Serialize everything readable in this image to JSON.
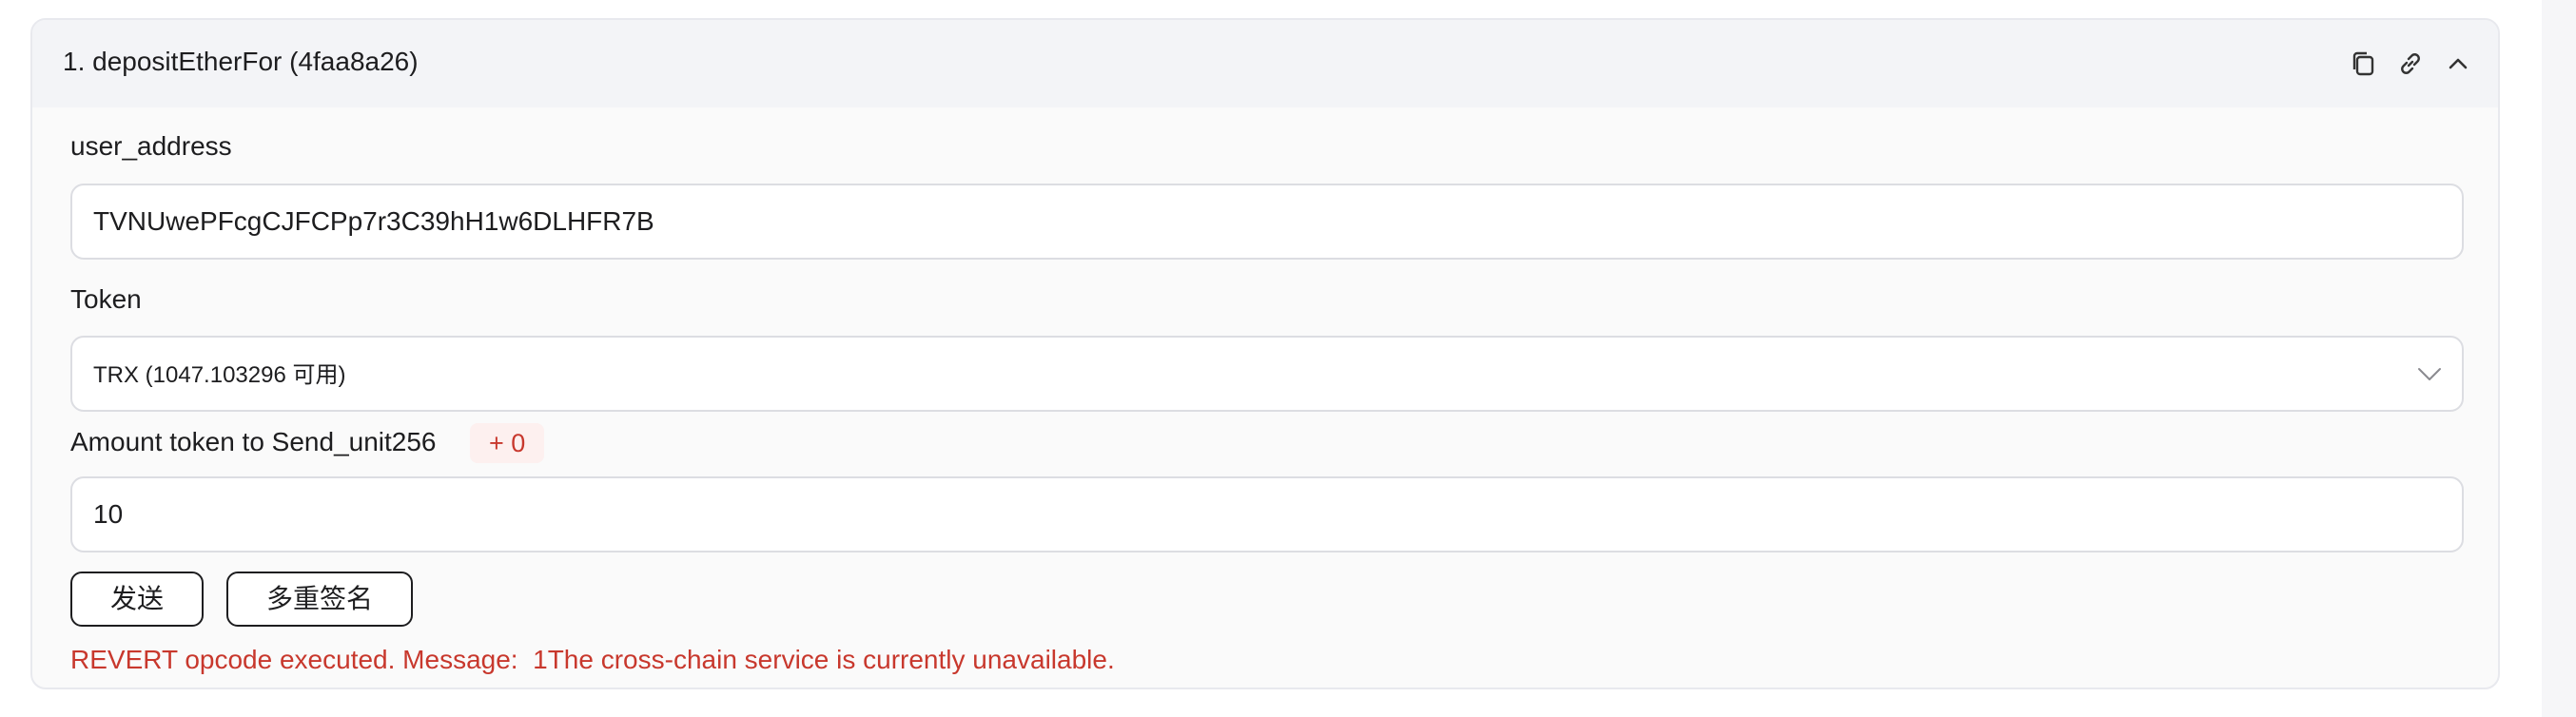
{
  "function_card": {
    "title": "1. depositEtherFor (4faa8a26)",
    "header_icons": [
      "copy-icon",
      "link-icon",
      "chevron-up-icon"
    ]
  },
  "fields": {
    "user_address": {
      "label": "user_address",
      "value": "TVNUwePFcgCJFCPp7r3C39hH1w6DLHFR7B"
    },
    "token": {
      "label": "Token",
      "selected": "TRX (1047.103296 可用)"
    },
    "amount": {
      "label": "Amount token to Send_unit256",
      "badge": "+ 0",
      "value": "10"
    }
  },
  "buttons": {
    "send": "发送",
    "multisig": "多重签名"
  },
  "error": {
    "message": "REVERT opcode executed. Message:  1The cross-chain service is currently unavailable."
  },
  "colors": {
    "error": "#c8382d",
    "header_bg": "#f3f4f7",
    "card_bg": "#fafafa",
    "badge_bg": "#fdf0ef"
  }
}
